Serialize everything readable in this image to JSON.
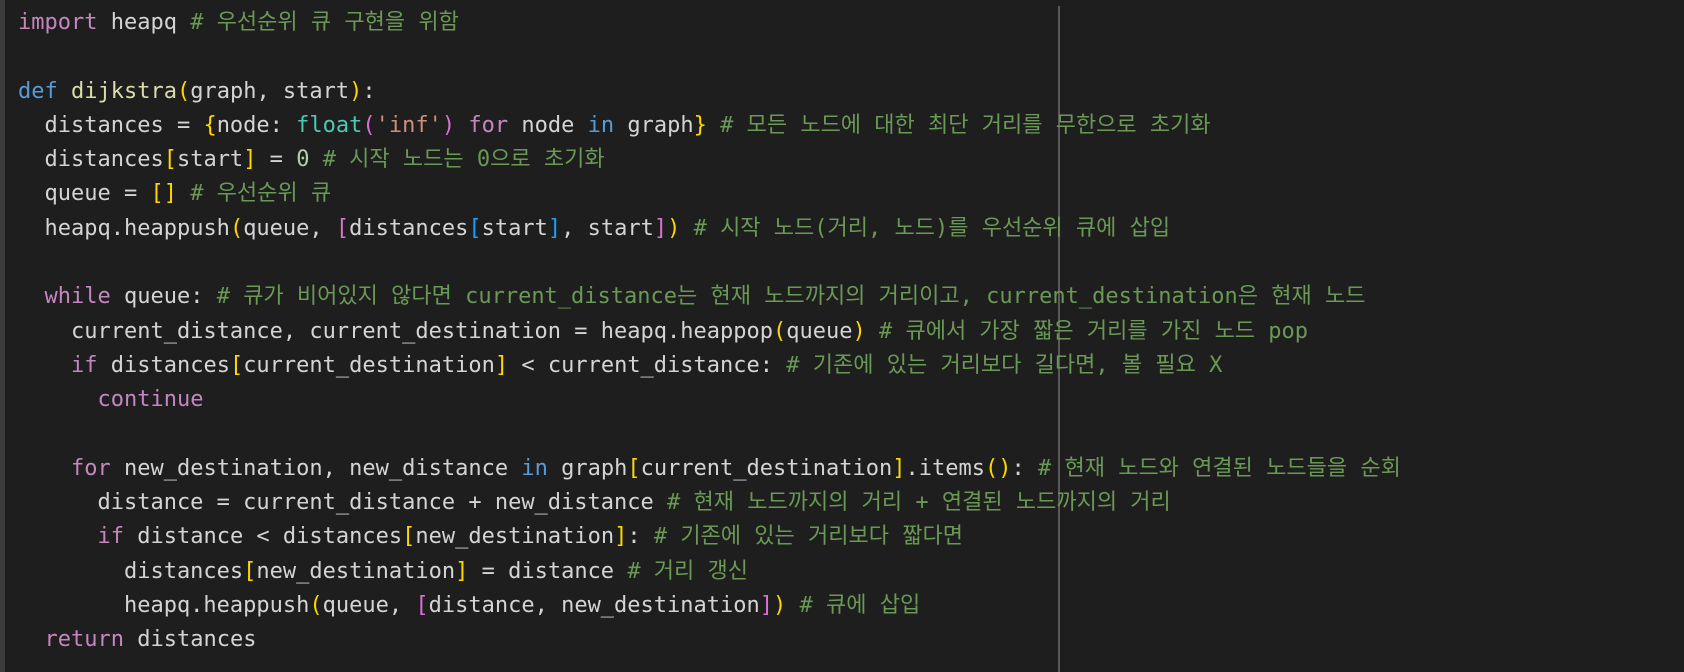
{
  "editor": {
    "colors": {
      "background": "#1e1e1e",
      "keyword_control": "#c586c0",
      "keyword_def": "#569cd6",
      "function": "#dcdcaa",
      "builtin": "#4ec9b0",
      "string": "#ce9178",
      "number": "#b5cea8",
      "comment": "#6a9955",
      "bracket_1": "#ffd700",
      "bracket_2": "#da70d6",
      "bracket_3": "#179fff",
      "text": "#d4d4d4"
    },
    "lines": [
      [
        {
          "t": "import",
          "c": "kw"
        },
        {
          "t": " heapq ",
          "c": "txt"
        },
        {
          "t": "# 우선순위 큐 구현을 위함",
          "c": "cm"
        }
      ],
      [],
      [
        {
          "t": "def",
          "c": "kwb"
        },
        {
          "t": " ",
          "c": "txt"
        },
        {
          "t": "dijkstra",
          "c": "fn"
        },
        {
          "t": "(",
          "c": "b1"
        },
        {
          "t": "graph, start",
          "c": "txt"
        },
        {
          "t": ")",
          "c": "b1"
        },
        {
          "t": ":",
          "c": "txt"
        }
      ],
      [
        {
          "t": "  distances = ",
          "c": "txt"
        },
        {
          "t": "{",
          "c": "b1"
        },
        {
          "t": "node: ",
          "c": "txt"
        },
        {
          "t": "float",
          "c": "bi"
        },
        {
          "t": "(",
          "c": "b2"
        },
        {
          "t": "'inf'",
          "c": "str"
        },
        {
          "t": ")",
          "c": "b2"
        },
        {
          "t": " ",
          "c": "txt"
        },
        {
          "t": "for",
          "c": "kw"
        },
        {
          "t": " node ",
          "c": "txt"
        },
        {
          "t": "in",
          "c": "kwb"
        },
        {
          "t": " graph",
          "c": "txt"
        },
        {
          "t": "}",
          "c": "b1"
        },
        {
          "t": " ",
          "c": "txt"
        },
        {
          "t": "# 모든 노드에 대한 최단 거리를 무한으로 초기화",
          "c": "cm"
        }
      ],
      [
        {
          "t": "  distances",
          "c": "txt"
        },
        {
          "t": "[",
          "c": "b1"
        },
        {
          "t": "start",
          "c": "txt"
        },
        {
          "t": "]",
          "c": "b1"
        },
        {
          "t": " = ",
          "c": "txt"
        },
        {
          "t": "0",
          "c": "num"
        },
        {
          "t": " ",
          "c": "txt"
        },
        {
          "t": "# 시작 노드는 0으로 초기화",
          "c": "cm"
        }
      ],
      [
        {
          "t": "  queue = ",
          "c": "txt"
        },
        {
          "t": "[]",
          "c": "b1"
        },
        {
          "t": " ",
          "c": "txt"
        },
        {
          "t": "# 우선순위 큐",
          "c": "cm"
        }
      ],
      [
        {
          "t": "  heapq.",
          "c": "txt"
        },
        {
          "t": "heappush",
          "c": "txt"
        },
        {
          "t": "(",
          "c": "b1"
        },
        {
          "t": "queue, ",
          "c": "txt"
        },
        {
          "t": "[",
          "c": "b2"
        },
        {
          "t": "distances",
          "c": "txt"
        },
        {
          "t": "[",
          "c": "b3"
        },
        {
          "t": "start",
          "c": "txt"
        },
        {
          "t": "]",
          "c": "b3"
        },
        {
          "t": ", start",
          "c": "txt"
        },
        {
          "t": "]",
          "c": "b2"
        },
        {
          "t": ")",
          "c": "b1"
        },
        {
          "t": " ",
          "c": "txt"
        },
        {
          "t": "# 시작 노드(거리, 노드)를 우선순위 큐에 삽입",
          "c": "cm"
        }
      ],
      [],
      [
        {
          "t": "  ",
          "c": "txt"
        },
        {
          "t": "while",
          "c": "kw"
        },
        {
          "t": " queue: ",
          "c": "txt"
        },
        {
          "t": "# 큐가 비어있지 않다면 current_distance는 현재 노드까지의 거리이고, current_destination은 현재 노드",
          "c": "cm"
        }
      ],
      [
        {
          "t": "    current_distance, current_destination = heapq.heappop",
          "c": "txt"
        },
        {
          "t": "(",
          "c": "b1"
        },
        {
          "t": "queue",
          "c": "txt"
        },
        {
          "t": ")",
          "c": "b1"
        },
        {
          "t": " ",
          "c": "txt"
        },
        {
          "t": "# 큐에서 가장 짧은 거리를 가진 노드 pop",
          "c": "cm"
        }
      ],
      [
        {
          "t": "    ",
          "c": "txt"
        },
        {
          "t": "if",
          "c": "kw"
        },
        {
          "t": " distances",
          "c": "txt"
        },
        {
          "t": "[",
          "c": "b1"
        },
        {
          "t": "current_destination",
          "c": "txt"
        },
        {
          "t": "]",
          "c": "b1"
        },
        {
          "t": " < current_distance: ",
          "c": "txt"
        },
        {
          "t": "# 기존에 있는 거리보다 길다면, 볼 필요 X",
          "c": "cm"
        }
      ],
      [
        {
          "t": "      ",
          "c": "txt"
        },
        {
          "t": "continue",
          "c": "kw"
        }
      ],
      [],
      [
        {
          "t": "    ",
          "c": "txt"
        },
        {
          "t": "for",
          "c": "kw"
        },
        {
          "t": " new_destination, new_distance ",
          "c": "txt"
        },
        {
          "t": "in",
          "c": "kwb"
        },
        {
          "t": " graph",
          "c": "txt"
        },
        {
          "t": "[",
          "c": "b1"
        },
        {
          "t": "current_destination",
          "c": "txt"
        },
        {
          "t": "]",
          "c": "b1"
        },
        {
          "t": ".items",
          "c": "txt"
        },
        {
          "t": "()",
          "c": "b1"
        },
        {
          "t": ": ",
          "c": "txt"
        },
        {
          "t": "# 현재 노드와 연결된 노드들을 순회",
          "c": "cm"
        }
      ],
      [
        {
          "t": "      distance = current_distance + new_distance ",
          "c": "txt"
        },
        {
          "t": "# 현재 노드까지의 거리 + 연결된 노드까지의 거리",
          "c": "cm"
        }
      ],
      [
        {
          "t": "      ",
          "c": "txt"
        },
        {
          "t": "if",
          "c": "kw"
        },
        {
          "t": " distance < distances",
          "c": "txt"
        },
        {
          "t": "[",
          "c": "b1"
        },
        {
          "t": "new_destination",
          "c": "txt"
        },
        {
          "t": "]",
          "c": "b1"
        },
        {
          "t": ": ",
          "c": "txt"
        },
        {
          "t": "# 기존에 있는 거리보다 짧다면",
          "c": "cm"
        }
      ],
      [
        {
          "t": "        distances",
          "c": "txt"
        },
        {
          "t": "[",
          "c": "b1"
        },
        {
          "t": "new_destination",
          "c": "txt"
        },
        {
          "t": "]",
          "c": "b1"
        },
        {
          "t": " = distance ",
          "c": "txt"
        },
        {
          "t": "# 거리 갱신",
          "c": "cm"
        }
      ],
      [
        {
          "t": "        heapq.heappush",
          "c": "txt"
        },
        {
          "t": "(",
          "c": "b1"
        },
        {
          "t": "queue, ",
          "c": "txt"
        },
        {
          "t": "[",
          "c": "b2"
        },
        {
          "t": "distance, new_destination",
          "c": "txt"
        },
        {
          "t": "]",
          "c": "b2"
        },
        {
          "t": ")",
          "c": "b1"
        },
        {
          "t": " ",
          "c": "txt"
        },
        {
          "t": "# 큐에 삽입",
          "c": "cm"
        }
      ],
      [
        {
          "t": "  ",
          "c": "txt"
        },
        {
          "t": "return",
          "c": "kw"
        },
        {
          "t": " distances",
          "c": "txt"
        }
      ]
    ]
  }
}
